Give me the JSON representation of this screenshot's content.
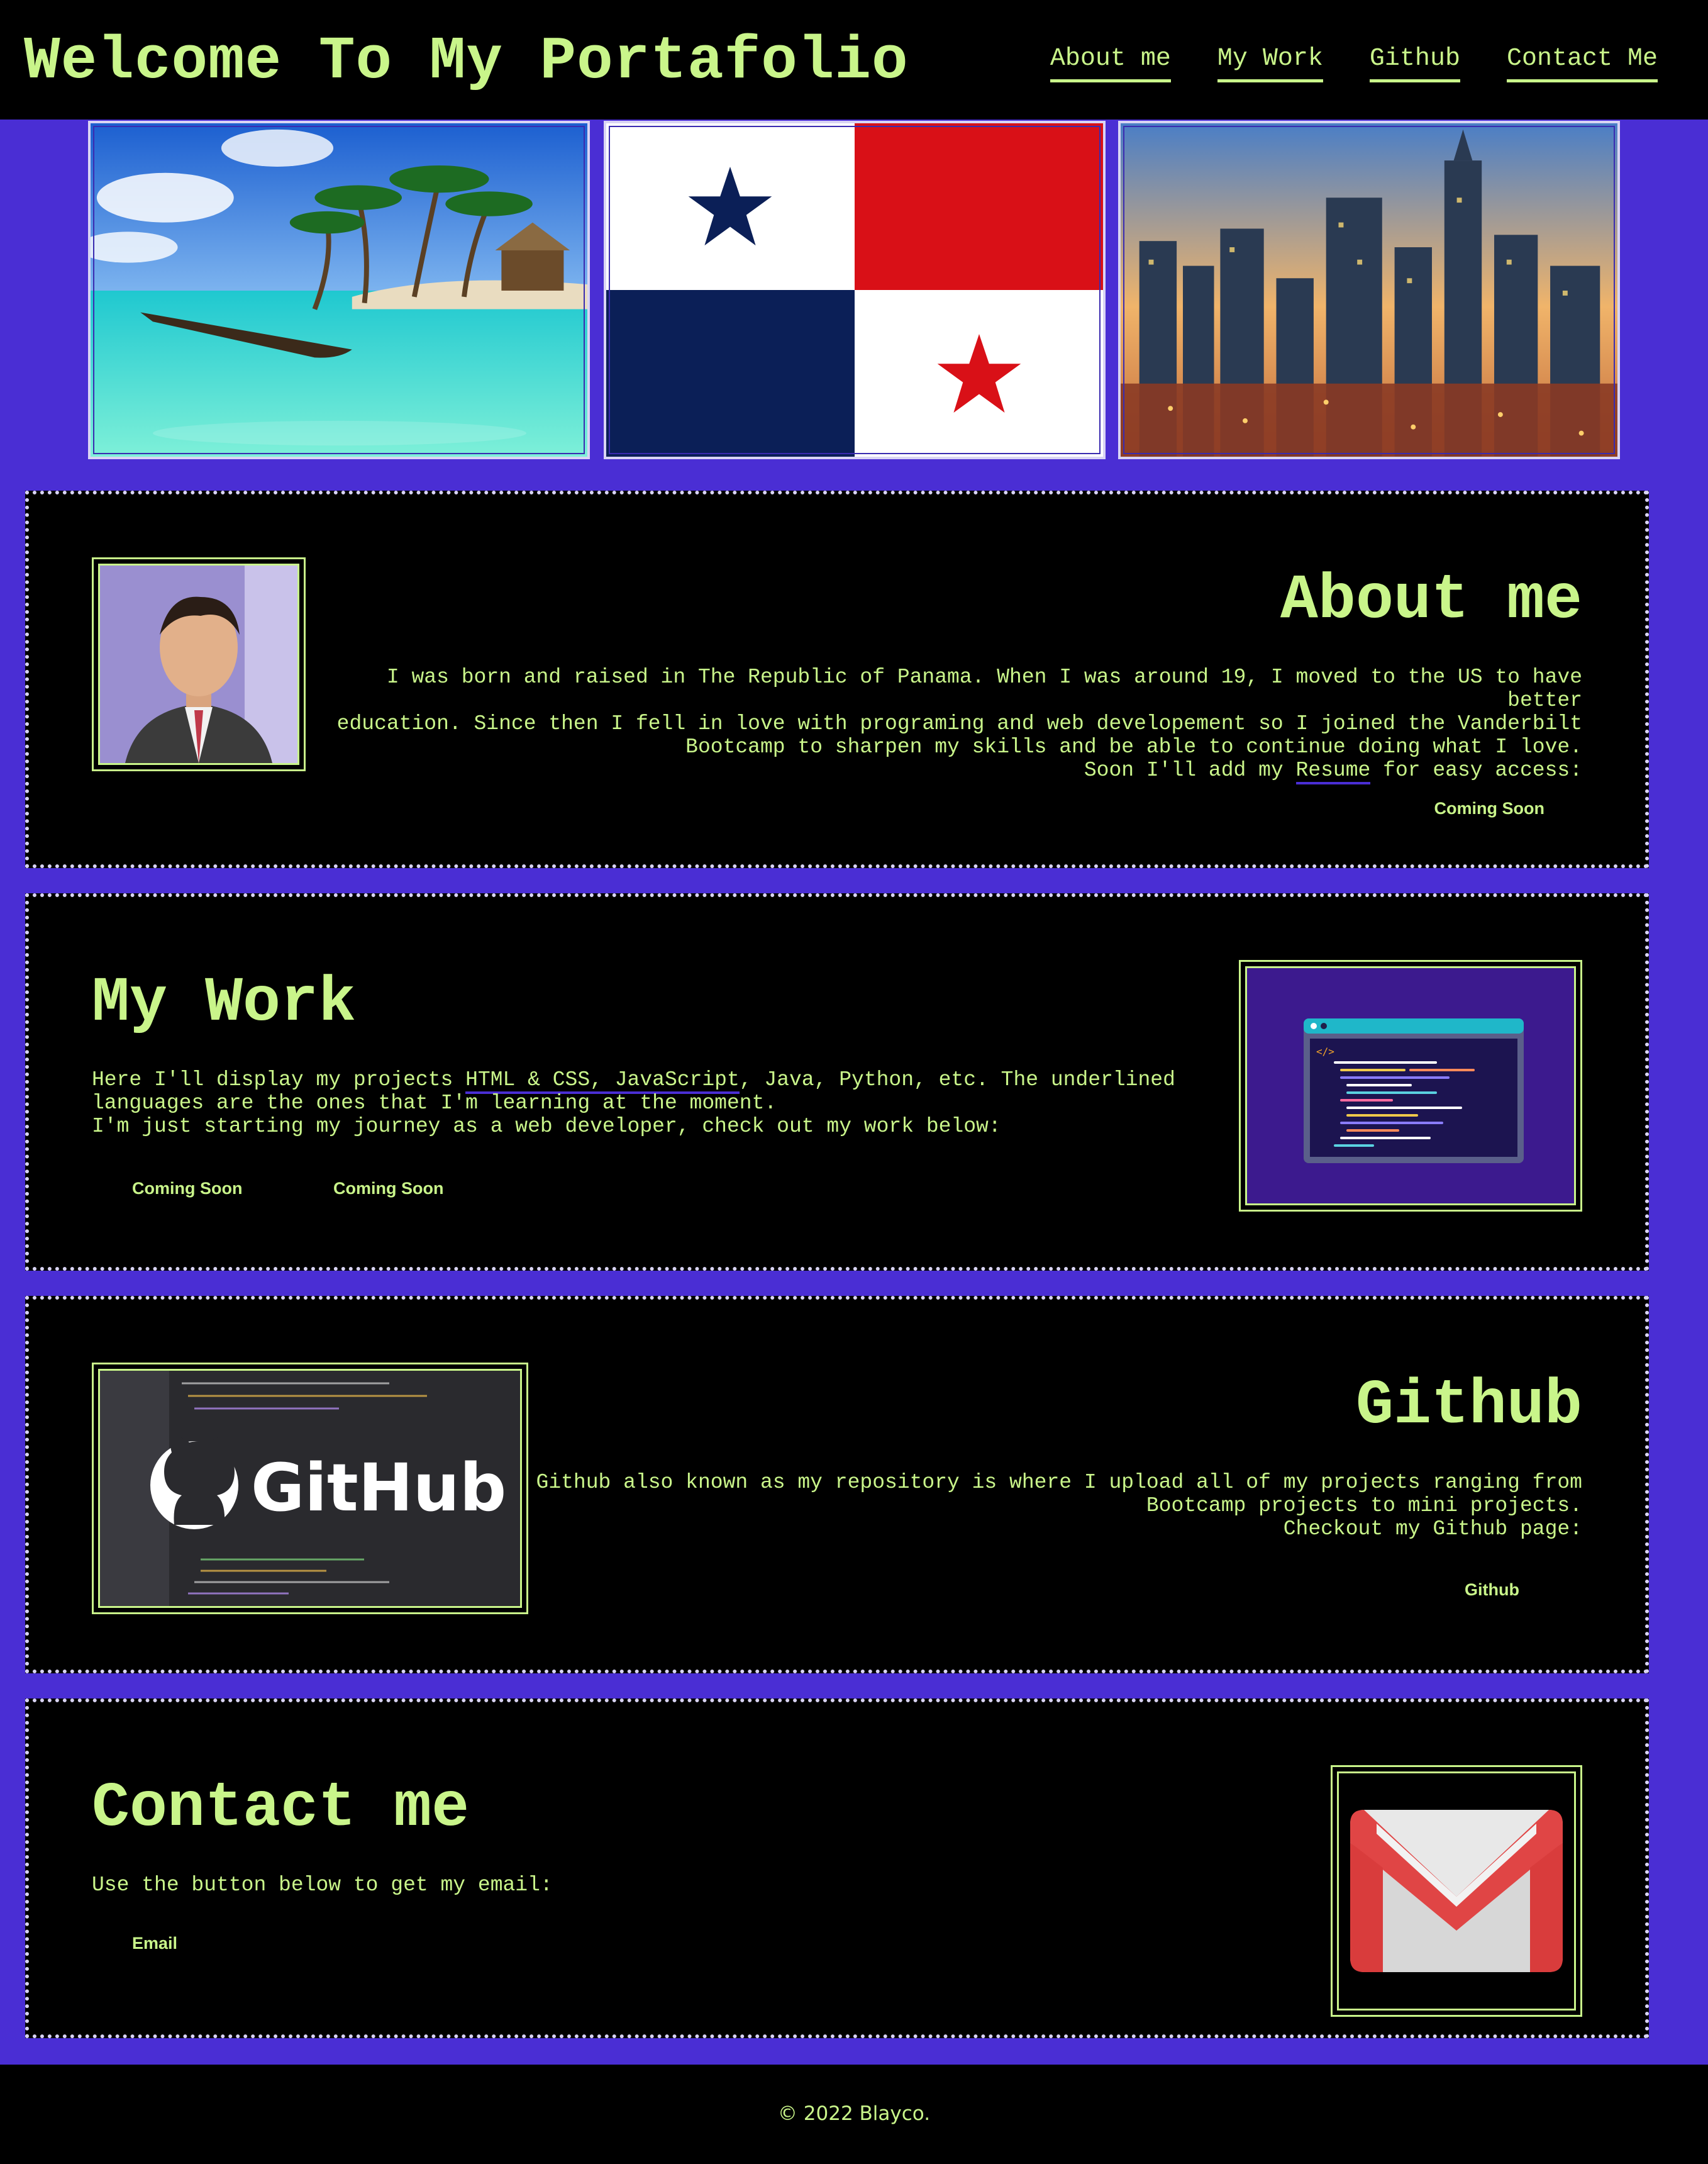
{
  "header": {
    "title": "Welcome To My Portafolio",
    "nav": [
      "About me",
      "My Work",
      "Github",
      "Contact Me"
    ]
  },
  "banner": {
    "images": [
      "beach-image",
      "panama-flag-image",
      "city-skyline-image"
    ]
  },
  "about": {
    "heading": "About me",
    "line1": "I was born and raised in The Republic of Panama. When I was around 19, I moved to the US to have better",
    "line2": "education. Since then I fell in love with programing and web developement so I joined the Vanderbilt",
    "line3": "Bootcamp to sharpen my skills and be able to continue doing what I love.",
    "line4_pre": "Soon I'll add my ",
    "line4_link": "Resume",
    "line4_post": " for easy access:",
    "button": "Coming Soon"
  },
  "work": {
    "heading": "My Work",
    "line1_pre": "Here I'll display my projects ",
    "line1_link": "HTML & CSS, JavaScript",
    "line1_post": ", Java, Python, etc. The underlined",
    "line2": "languages are the ones that I'm learning at the moment.",
    "line3": "I'm just starting my journey as a web developer, check out my work below:",
    "buttons": [
      "Coming Soon",
      "Coming Soon"
    ]
  },
  "github": {
    "heading": "Github",
    "line1": "Github also known as my repository is where I upload all of my projects ranging from",
    "line2": "Bootcamp projects to mini projects.",
    "line3": "Checkout my Github page:",
    "button": "Github",
    "logo_text": "GitHub"
  },
  "contact": {
    "heading": "Contact me",
    "line1": "Use the button below to get my email:",
    "button": "Email"
  },
  "footer": {
    "text": "© 2022 Blayco."
  },
  "colors": {
    "accent": "#c9f58a",
    "background": "#4a2ed4",
    "panel": "#000000"
  }
}
